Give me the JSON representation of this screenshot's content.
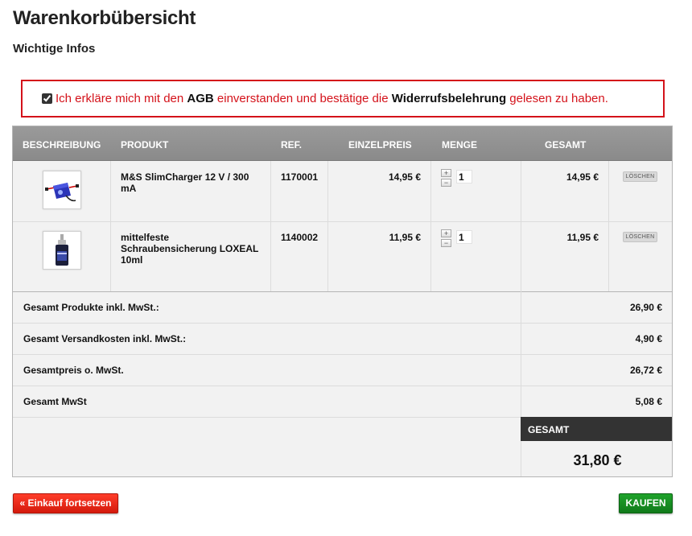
{
  "page": {
    "title": "Warenkorbübersicht",
    "subtitle": "Wichtige Infos"
  },
  "agb": {
    "checked": true,
    "text_before": "Ich erkläre mich mit den ",
    "agb_link": "AGB",
    "text_middle": " einverstanden und bestätige die ",
    "widerruf_link": "Widerrufsbelehrung",
    "text_after": " gelesen zu haben."
  },
  "table": {
    "headers": {
      "beschreibung": "BESCHREIBUNG",
      "produkt": "PRODUKT",
      "ref": "REF.",
      "einzelpreis": "EINZELPREIS",
      "menge": "MENGE",
      "gesamt": "GESAMT"
    },
    "rows": [
      {
        "image_icon": "charger-product-image",
        "product": "M&S SlimCharger 12 V / 300 mA",
        "ref": "1170001",
        "unit_price": "14,95 €",
        "quantity": "1",
        "total": "14,95 €",
        "delete_label": "LÖSCHEN"
      },
      {
        "image_icon": "bottle-product-image",
        "product": "mittelfeste Schraubensicherung LOXEAL 10ml",
        "ref": "1140002",
        "unit_price": "11,95 €",
        "quantity": "1",
        "total": "11,95 €",
        "delete_label": "LÖSCHEN"
      }
    ],
    "stepper": {
      "plus": "+",
      "minus": "−"
    }
  },
  "summary": {
    "products_label": "Gesamt Produkte inkl. MwSt.:",
    "products_value": "26,90 €",
    "shipping_label": "Gesamt Versandkosten inkl. MwSt.:",
    "shipping_value": "4,90 €",
    "net_label": "Gesamtpreis o. MwSt.",
    "net_value": "26,72 €",
    "vat_label": "Gesamt MwSt",
    "vat_value": "5,08 €",
    "total_label": "GESAMT",
    "total_value": "31,80 €"
  },
  "buttons": {
    "back": "« Einkauf fortsetzen",
    "buy": "KAUFEN"
  },
  "colors": {
    "accent_red": "#d4121a",
    "buy_green": "#1fa32b",
    "header_gray": "#9a9a9a",
    "total_dark": "#333333"
  }
}
